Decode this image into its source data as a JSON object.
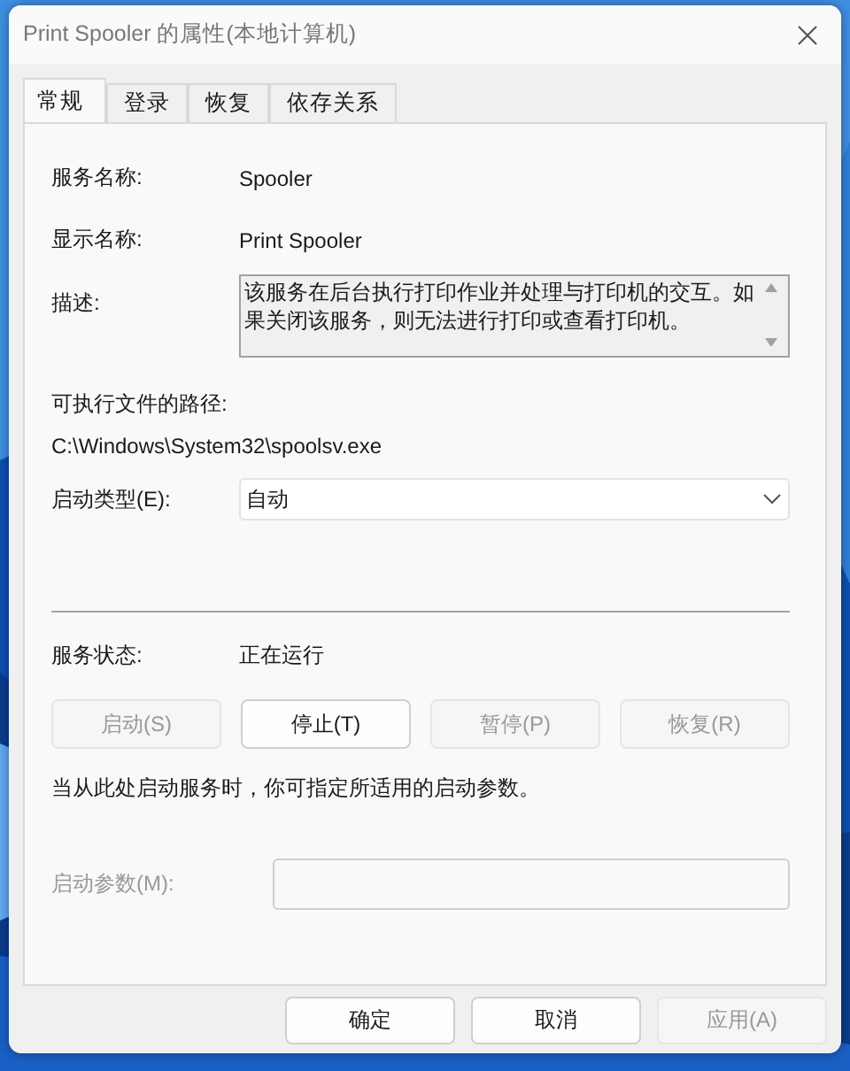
{
  "window": {
    "title": "Print Spooler 的属性(本地计算机)"
  },
  "tabs": [
    {
      "label": "常规",
      "selected": true
    },
    {
      "label": "登录",
      "selected": false
    },
    {
      "label": "恢复",
      "selected": false
    },
    {
      "label": "依存关系",
      "selected": false
    }
  ],
  "service_name": {
    "label": "服务名称:",
    "value": "Spooler"
  },
  "display_name": {
    "label": "显示名称:",
    "value": "Print Spooler"
  },
  "description": {
    "label": "描述:",
    "text": "该服务在后台执行打印作业并处理与打印机的交互。如果关闭该服务，则无法进行打印或查看打印机。"
  },
  "executable_path": {
    "label": "可执行文件的路径:",
    "value": "C:\\Windows\\System32\\spoolsv.exe"
  },
  "startup_type": {
    "label": "启动类型(E):",
    "value": "自动"
  },
  "service_status": {
    "label": "服务状态:",
    "value": "正在运行"
  },
  "service_buttons": [
    {
      "label": "启动(S)",
      "disabled": true
    },
    {
      "label": "停止(T)",
      "disabled": false
    },
    {
      "label": "暂停(P)",
      "disabled": true
    },
    {
      "label": "恢复(R)",
      "disabled": true
    }
  ],
  "hint": "当从此处启动服务时，你可指定所适用的启动参数。",
  "start_parameters": {
    "label": "启动参数(M):",
    "disabled": true
  },
  "dialog_buttons": [
    {
      "label": "确定",
      "disabled": false
    },
    {
      "label": "取消",
      "disabled": false
    },
    {
      "label": "应用(A)",
      "disabled": true
    }
  ]
}
